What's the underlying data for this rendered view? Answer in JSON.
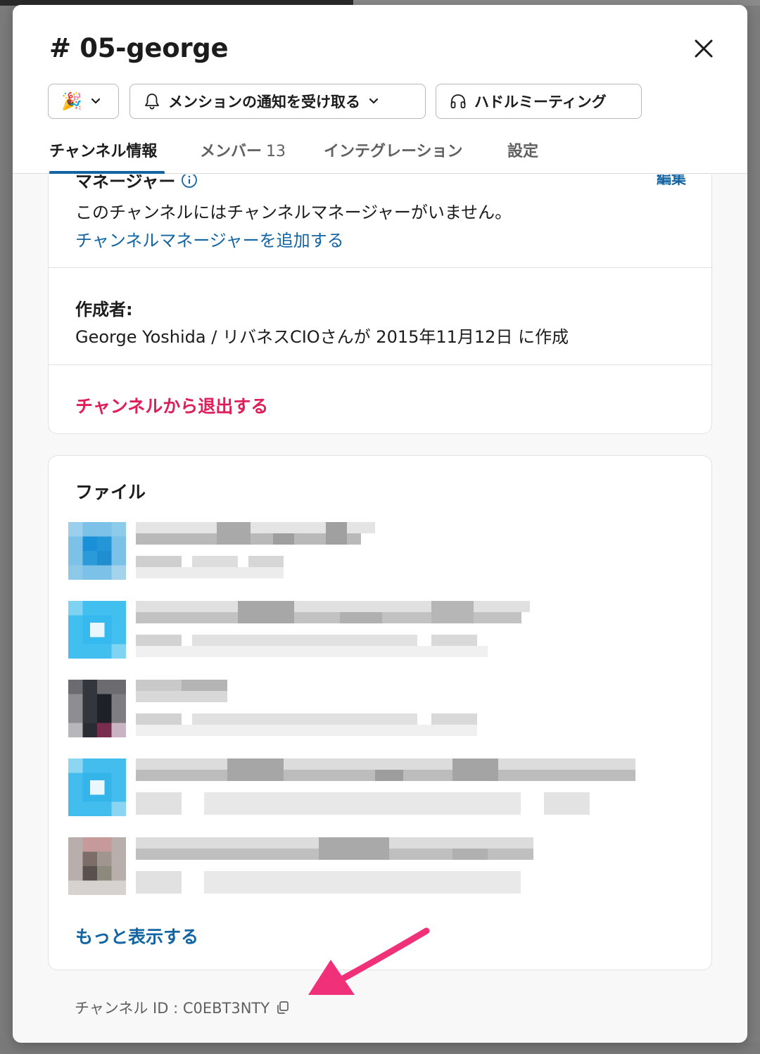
{
  "channel": {
    "title": "# 05-george"
  },
  "header_buttons": {
    "emoji_label": "🎉",
    "notify_label": "メンションの通知を受け取る",
    "huddle_label": "ハドルミーティング"
  },
  "tabs": [
    {
      "label": "チャンネル情報",
      "active": true
    },
    {
      "label": "メンバー",
      "count": "13"
    },
    {
      "label": "インテグレーション"
    },
    {
      "label": "設定"
    }
  ],
  "managers": {
    "heading": "マネージャー",
    "edit_label": "編集",
    "empty_text": "このチャンネルにはチャンネルマネージャーがいません。",
    "add_link": "チャンネルマネージャーを追加する"
  },
  "creator": {
    "label": "作成者:",
    "text": "George Yoshida / リバネスCIOさんが 2015年11月12日 に作成"
  },
  "leave_label": "チャンネルから退出する",
  "files": {
    "heading": "ファイル",
    "more_label": "もっと表示する"
  },
  "channel_id": {
    "text": "チャンネル ID : C0EBT3NTY"
  },
  "colors": {
    "link_blue": "#1264a3",
    "leave_red": "#e01e5a",
    "arrow_pink": "#f0317a"
  }
}
